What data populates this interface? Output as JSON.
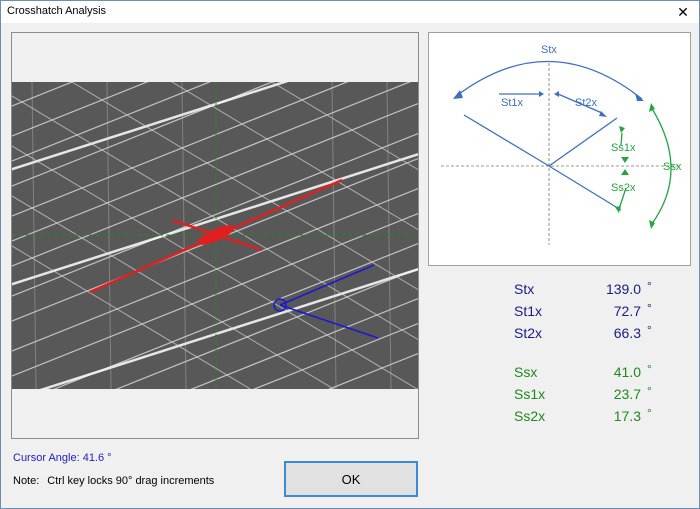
{
  "window": {
    "title": "Crosshatch Analysis",
    "close_glyph": "✕"
  },
  "diagram": {
    "labels": {
      "stx": "Stx",
      "st1x": "St1x",
      "st2x": "St2x",
      "ssx": "Ssx",
      "ss1x": "Ss1x",
      "ss2x": "Ss2x"
    },
    "blue_color": "#3d6fc4",
    "green_color": "#1fa83c"
  },
  "values": {
    "rows": [
      {
        "label": "Stx",
        "value": "139.0",
        "unit": "°"
      },
      {
        "label": "St1x",
        "value": "72.7",
        "unit": "°"
      },
      {
        "label": "St2x",
        "value": "66.3",
        "unit": "°"
      },
      {
        "label": "Ssx",
        "value": "41.0",
        "unit": "°"
      },
      {
        "label": "Ss1x",
        "value": "23.7",
        "unit": "°"
      },
      {
        "label": "Ss2x",
        "value": "17.3",
        "unit": "°"
      }
    ]
  },
  "status": {
    "cursor_angle": "Cursor Angle: 41.6 °",
    "note_prefix": "Note:",
    "note_text": "Ctrl key locks 90° drag increments"
  },
  "buttons": {
    "ok_label": "OK"
  }
}
